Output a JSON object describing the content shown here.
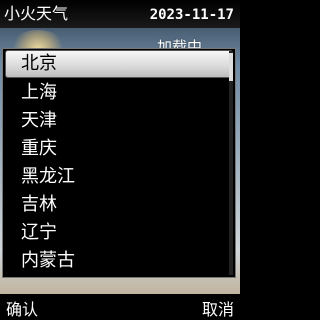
{
  "header": {
    "app_title": "小火天气",
    "date": "2023-11-17"
  },
  "main": {
    "loading_text": "加载中……"
  },
  "city_list": {
    "selected_index": 0,
    "items": [
      "北京",
      "上海",
      "天津",
      "重庆",
      "黑龙江",
      "吉林",
      "辽宁",
      "内蒙古"
    ]
  },
  "softkeys": {
    "left": "确认",
    "right": "取消"
  },
  "colors": {
    "highlight": "#e6e6e6",
    "background": "#000000"
  },
  "icons": {
    "background": "sun-glow-icon"
  }
}
